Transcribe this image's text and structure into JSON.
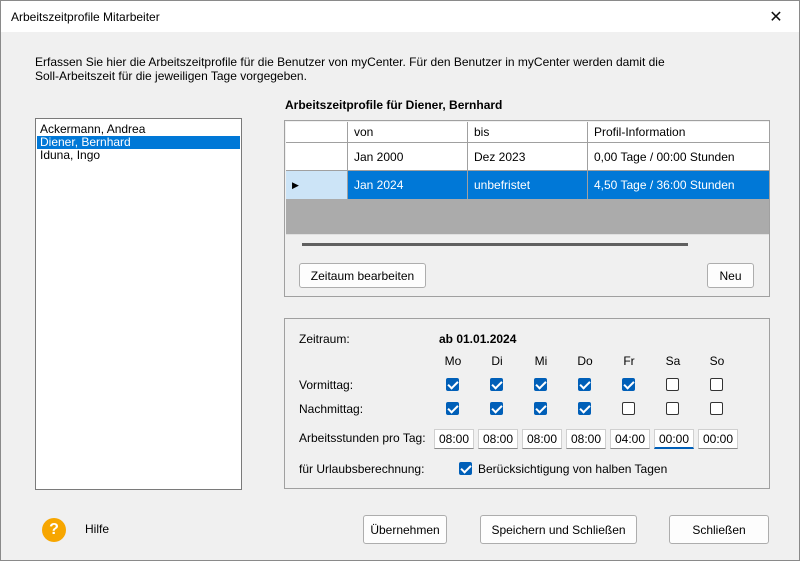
{
  "window": {
    "title": "Arbeitszeitprofile Mitarbeiter",
    "close_glyph": "✕"
  },
  "intro": "Erfassen Sie hier die Arbeitszeitprofile für die Benutzer von myCenter. Für den Benutzer in myCenter werden damit die Soll-Arbeitszeit für die jeweiligen Tage vorgegeben.",
  "users": [
    {
      "name": "Ackermann, Andrea",
      "selected": false
    },
    {
      "name": "Diener, Bernhard",
      "selected": true
    },
    {
      "name": "Iduna, Ingo",
      "selected": false
    }
  ],
  "profile_title": "Arbeitszeitprofile für  Diener, Bernhard",
  "grid": {
    "headers": [
      "von",
      "bis",
      "Profil-Information"
    ],
    "rows": [
      {
        "von": "Jan 2000",
        "bis": "Dez 2023",
        "info": "0,00 Tage / 00:00 Stunden",
        "selected": false
      },
      {
        "von": "Jan 2024",
        "bis": "unbefristet",
        "info": "4,50 Tage / 36:00 Stunden",
        "selected": true
      }
    ],
    "row_indicator": "▶"
  },
  "buttons": {
    "edit_period": "Zeitaum bearbeiten",
    "new": "Neu",
    "apply": "Übernehmen",
    "save_close": "Speichern und Schließen",
    "close": "Schließen"
  },
  "detail": {
    "period_label": "Zeitraum:",
    "period_value": "ab 01.01.2024",
    "days": [
      "Mo",
      "Di",
      "Mi",
      "Do",
      "Fr",
      "Sa",
      "So"
    ],
    "morning_label": "Vormittag:",
    "afternoon_label": "Nachmittag:",
    "morning": [
      true,
      true,
      true,
      true,
      true,
      false,
      false
    ],
    "afternoon": [
      true,
      true,
      true,
      true,
      false,
      false,
      false
    ],
    "hours_label": "Arbeitsstunden pro Tag:",
    "hours": [
      "08:00",
      "08:00",
      "08:00",
      "08:00",
      "04:00",
      "00:00",
      "00:00"
    ],
    "vacation_label": "für Urlaubsberechnung:",
    "half_days_label": "Berücksichtigung von halben Tagen",
    "half_days_checked": true
  },
  "help": {
    "icon": "question-icon",
    "glyph": "?",
    "label": "Hilfe"
  },
  "colors": {
    "selection": "#0078d7",
    "accent": "#005fb8",
    "help": "#f7a600"
  }
}
